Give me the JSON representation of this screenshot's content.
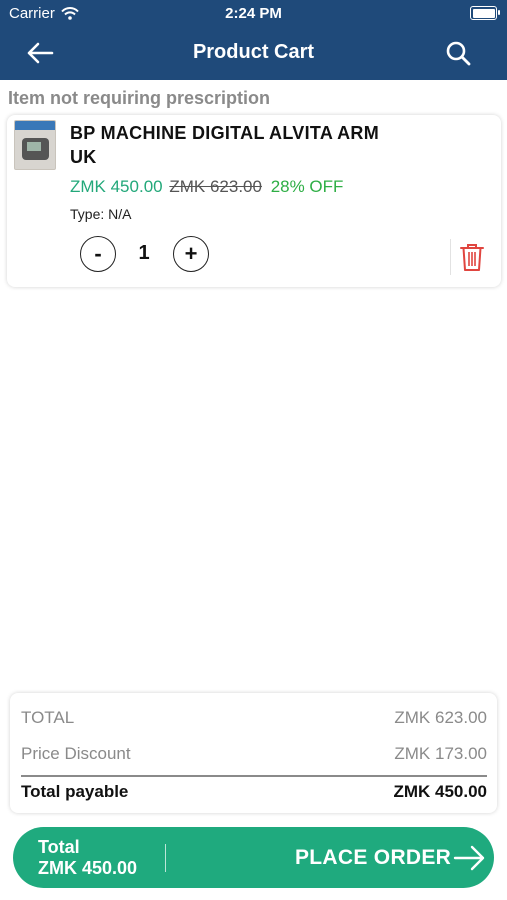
{
  "status_bar": {
    "carrier": "Carrier",
    "time": "2:24 PM"
  },
  "header": {
    "title": "Product Cart",
    "back_icon": "arrow-left-icon",
    "search_icon": "search-icon",
    "background": "#1f4a7a"
  },
  "section": {
    "label": "Item not requiring prescription"
  },
  "cart_item": {
    "name": "BP MACHINE DIGITAL ALVITA ARM UK",
    "price": "ZMK 450.00",
    "old_price": "ZMK 623.00",
    "discount": "28% OFF",
    "type": "Type: N/A",
    "quantity": "1",
    "minus_label": "-",
    "plus_label": "+",
    "delete_icon": "trash-icon"
  },
  "summary": {
    "total_label": "TOTAL",
    "total_value": "ZMK 623.00",
    "discount_label": "Price Discount",
    "discount_value": "ZMK 173.00",
    "payable_label": "Total payable",
    "payable_value": "ZMK 450.00"
  },
  "order_bar": {
    "total_label": "Total",
    "total_value": "ZMK 450.00",
    "button_label": "PLACE ORDER",
    "arrow_icon": "arrow-right-icon",
    "color": "#1faa7e"
  },
  "colors": {
    "price_green": "#23a87a",
    "discount_green": "#2eae45",
    "delete_red": "#e0453f"
  }
}
